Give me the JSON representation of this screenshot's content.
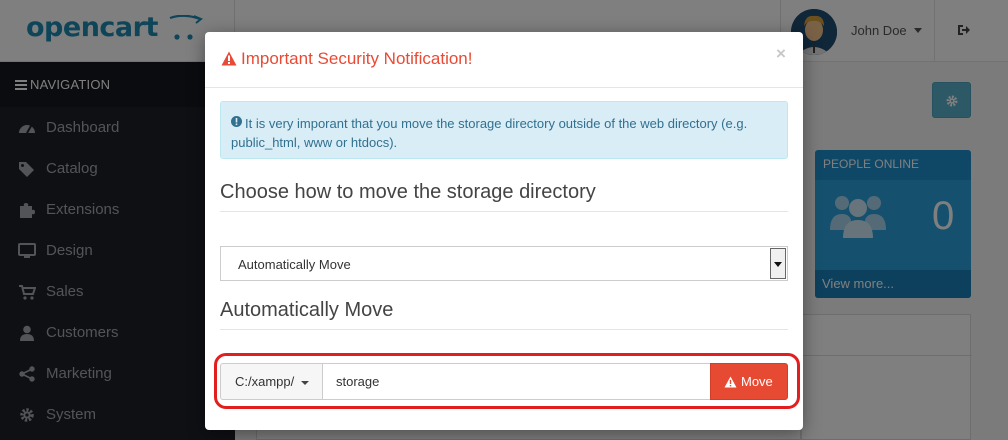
{
  "app": {
    "logo_text": "opencart",
    "brand_color": "#1d8ab2"
  },
  "header": {
    "user_name": "John Doe",
    "logout_icon": "sign-out-icon"
  },
  "sidebar": {
    "nav_header": "NAVIGATION",
    "items": [
      {
        "label": "Dashboard",
        "icon": "dashboard-icon"
      },
      {
        "label": "Catalog",
        "icon": "tags-icon"
      },
      {
        "label": "Extensions",
        "icon": "puzzle-icon"
      },
      {
        "label": "Design",
        "icon": "monitor-icon"
      },
      {
        "label": "Sales",
        "icon": "shopping-cart-icon"
      },
      {
        "label": "Customers",
        "icon": "user-icon"
      },
      {
        "label": "Marketing",
        "icon": "share-icon"
      },
      {
        "label": "System",
        "icon": "cog-icon"
      }
    ]
  },
  "dashboard": {
    "people_online": {
      "title": "PEOPLE ONLINE",
      "count": "0",
      "link": "View more..."
    }
  },
  "modal": {
    "title": "Important Security Notification!",
    "close": "×",
    "alert_text": "It is very imporant that you move the storage directory outside of the web directory (e.g. public_html, www or htdocs).",
    "choose_title": "Choose how to move the storage directory",
    "select": {
      "value": "Automatically Move",
      "options": [
        "Automatically Move"
      ]
    },
    "auto_title": "Automatically Move",
    "path_prefix": "C:/xampp/",
    "storage_value": "storage",
    "move_label": "Move",
    "colors": {
      "danger": "#e64a33",
      "info_bg": "#d9edf7",
      "info_text": "#31708f",
      "highlight": "#e31e1e"
    }
  }
}
